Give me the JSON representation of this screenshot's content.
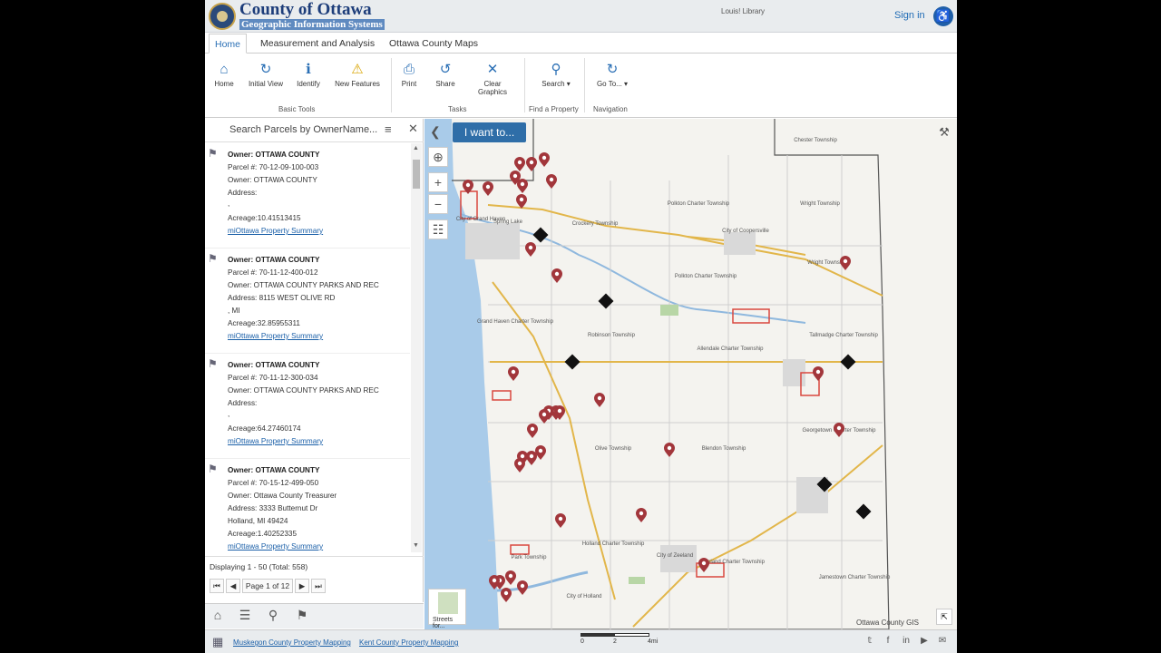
{
  "header": {
    "title": "County of Ottawa",
    "subtitle": "Geographic Information Systems",
    "library_label": "Louis! Library",
    "sign_in": "Sign in",
    "accessibility_icon": "wheelchair-icon"
  },
  "tabs": [
    {
      "label": "Home",
      "active": true
    },
    {
      "label": "Measurement and Analysis",
      "active": false
    },
    {
      "label": "Ottawa County Maps",
      "active": false
    }
  ],
  "ribbon": {
    "basic_tools": {
      "label": "Basic Tools",
      "buttons": [
        {
          "label": "Home",
          "icon": "home-icon"
        },
        {
          "label": "Initial View",
          "icon": "refresh-icon"
        },
        {
          "label": "Identify",
          "icon": "identify-icon"
        },
        {
          "label": "New Features",
          "icon": "warning-icon"
        }
      ]
    },
    "tasks": {
      "label": "Tasks",
      "buttons": [
        {
          "label": "Print",
          "icon": "printer-icon"
        },
        {
          "label": "Share",
          "icon": "share-icon"
        },
        {
          "label": "Clear Graphics",
          "icon": "close-icon"
        }
      ]
    },
    "find_property": {
      "label": "Find a Property",
      "button": "Search"
    },
    "navigation": {
      "label": "Navigation",
      "button": "Go To..."
    }
  },
  "panel": {
    "title": "Search Parcels by OwnerName...",
    "results": [
      {
        "owner_header": "Owner: OTTAWA COUNTY",
        "parcel": "Parcel #: 70-12-09-100-003",
        "owner": "Owner: OTTAWA COUNTY",
        "address": "Address:",
        "address2": ",",
        "acreage": "Acreage:10.41513415",
        "link": "miOttawa Property Summary"
      },
      {
        "owner_header": "Owner: OTTAWA COUNTY",
        "parcel": "Parcel #: 70-11-12-400-012",
        "owner": "Owner: OTTAWA COUNTY PARKS AND REC",
        "address": "Address: 8115 WEST OLIVE RD",
        "address2": ", MI",
        "acreage": "Acreage:32.85955311",
        "link": "miOttawa Property Summary"
      },
      {
        "owner_header": "Owner: OTTAWA COUNTY",
        "parcel": "Parcel #: 70-11-12-300-034",
        "owner": "Owner: OTTAWA COUNTY PARKS AND REC",
        "address": "Address:",
        "address2": ",",
        "acreage": "Acreage:64.27460174",
        "link": "miOttawa Property Summary"
      },
      {
        "owner_header": "Owner: OTTAWA COUNTY",
        "parcel": "Parcel #: 70-15-12-499-050",
        "owner": "Owner: Ottawa County Treasurer",
        "address": "Address: 3333 Butternut Dr",
        "address2": "Holland, MI 49424",
        "acreage": "Acreage:1.40252335",
        "link": "miOttawa Property Summary"
      }
    ],
    "display_count": "Displaying 1 - 50 (Total: 558)",
    "page_label": "Page 1 of 12"
  },
  "bottom_tools": [
    "home-icon",
    "layers-icon",
    "zoom-icon",
    "parcel-search-icon"
  ],
  "footer": {
    "links": [
      "Muskegon County Property Mapping",
      "Kent County Property Mapping"
    ],
    "scale_labels": [
      "0",
      "2",
      "4mi"
    ],
    "social_icons": [
      "twitter-icon",
      "facebook-icon",
      "linkedin-icon",
      "youtube-icon",
      "email-icon"
    ]
  },
  "map": {
    "i_want_to": "I want to...",
    "basemap_label": "Streets for...",
    "attribution": "Ottawa County GIS",
    "place_labels": [
      "Chester Township",
      "Polkton Charter Township",
      "Wright Township",
      "Crockery Township",
      "City of Coopersville",
      "Wright Township",
      "Polkton Charter Township",
      "Grand Haven Charter Township",
      "Robinson Township",
      "Allendale Charter Township",
      "Tallmadge Charter Township",
      "Olive Township",
      "Blendon Township",
      "Georgetown Charter Township",
      "Holland Charter Township",
      "City of Zeeland",
      "Zeeland Charter Township",
      "Jamestown Charter Township",
      "Park Township",
      "City of Holland",
      "Spring Lake",
      "City of Grand Haven"
    ],
    "colors": {
      "lake": "#a9cbe9",
      "marker": "#a2363b",
      "highway": "#e2b64a",
      "parcel": "#d9473f"
    }
  }
}
